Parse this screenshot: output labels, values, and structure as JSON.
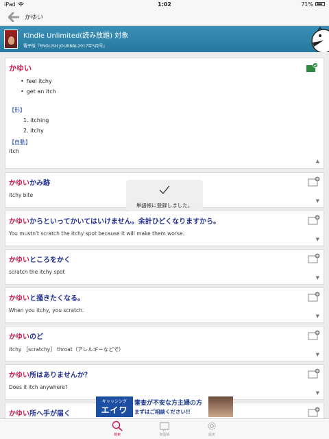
{
  "status": {
    "device": "iPad",
    "time": "1:02",
    "battery": "71%"
  },
  "search": {
    "query": "かゆい"
  },
  "banner": {
    "title": "Kindle Unlimited(読み放題) 対象",
    "subtitle": "電子版『ENGLISH JOURNAL2017年5月号』"
  },
  "entry": {
    "headword": "かゆい",
    "senses": [
      "feel itchy",
      "get an itch"
    ],
    "adjective_label": "【形】",
    "adjective_items": [
      "1. itching",
      "2. itchy"
    ],
    "verb_label": "【自動】",
    "verb_text": "itch"
  },
  "toast": {
    "message": "単語帳に登録しました。"
  },
  "results": [
    {
      "keyword": "かゆい",
      "rest": "かみ跡",
      "translation": "itchy bite"
    },
    {
      "keyword": "かゆい",
      "rest": "からといってかいてはいけません。余計ひどくなりますから。",
      "translation": "You mustn't scratch the itchy spot because it will make them worse."
    },
    {
      "keyword": "かゆい",
      "rest": "ところをかく",
      "translation": "scratch the itchy spot"
    },
    {
      "keyword": "かゆい",
      "rest": "と掻きたくなる。",
      "translation": "When you itchy, you scratch."
    },
    {
      "keyword": "かゆい",
      "rest": "のど",
      "translation": "itchy ［scratchy］ throat（アレルギーなどで）"
    },
    {
      "keyword": "かゆい",
      "rest": "所はありませんか？",
      "translation": "Does it itch anywhere?"
    },
    {
      "keyword": "かゆい",
      "rest": "所へ手が届く",
      "translation": ""
    }
  ],
  "ad": {
    "logo_small": "キャッシング",
    "logo_big": "エイワ",
    "line1": "審査が不安な方主婦の方",
    "line2": "まずはご相談ください!!"
  },
  "tabs": [
    {
      "label": "検索",
      "icon": "search-icon",
      "active": true
    },
    {
      "label": "単語帳",
      "icon": "wordbook-icon",
      "active": false
    },
    {
      "label": "設定",
      "icon": "gear-icon",
      "active": false
    }
  ],
  "colors": {
    "headword": "#d0184e",
    "phrase": "#23308f",
    "label": "#2a4fb0",
    "banner": "#3a8fb6",
    "active_tab": "#c2185b"
  }
}
